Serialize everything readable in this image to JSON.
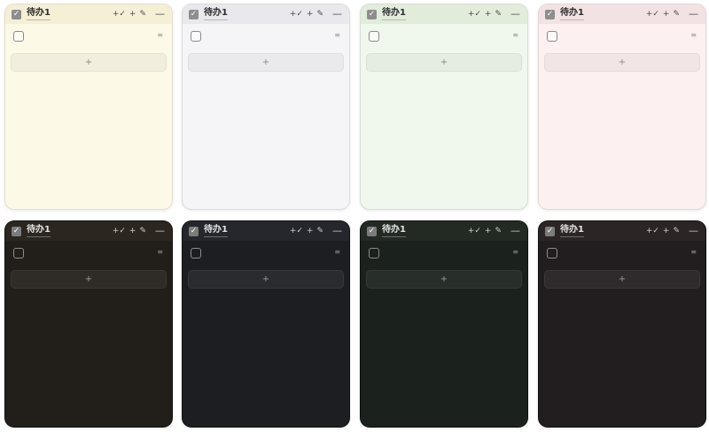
{
  "widget": {
    "title": "待办1",
    "title_check_glyph": "✓",
    "add_check_label": "+✓",
    "add_note_label": "+",
    "pen_glyph": "✎",
    "minimize_glyph": "—",
    "drag_handle_glyph": "≡",
    "add_item_label": "+"
  },
  "themes": {
    "light_row": [
      {
        "name": "yellow",
        "background": "#fdf9e7"
      },
      {
        "name": "gray",
        "background": "#f5f5f7"
      },
      {
        "name": "green",
        "background": "#f0f7ec"
      },
      {
        "name": "pink",
        "background": "#fcf0f1"
      }
    ],
    "dark_row": [
      {
        "name": "dark-brown",
        "background": "#221f1a"
      },
      {
        "name": "dark-navy",
        "background": "#1d1e22"
      },
      {
        "name": "dark-green",
        "background": "#1b211c"
      },
      {
        "name": "dark-maroon",
        "background": "#221d1e"
      }
    ]
  },
  "icons": {
    "title_check": "checkbox-checked-icon",
    "todo_check": "checkbox-empty-icon",
    "add_check": "add-check-icon",
    "add": "plus-icon",
    "pen": "pen-icon",
    "minimize": "minimize-icon",
    "drag": "drag-handle-icon"
  }
}
